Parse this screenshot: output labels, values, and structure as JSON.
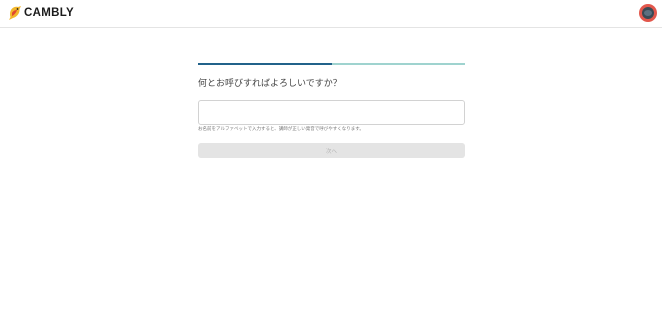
{
  "header": {
    "logo_text": "CAMBLY",
    "logo_icon": "cambly-bird-icon",
    "avatar_icon": "user-avatar"
  },
  "progress": {
    "value": 0.5
  },
  "form": {
    "question": "何とお呼びすればよろしいですか？",
    "name_value": "",
    "name_placeholder": "",
    "hint": "お名前をアルファベットで入力すると、講師が正しい発音で呼びやすくなります。",
    "next_label": "次へ"
  },
  "colors": {
    "progress_fill": "#21628a",
    "progress_track": "#9fd3cf",
    "button_disabled_bg": "#e4e4e4",
    "avatar": "#e2574c"
  }
}
